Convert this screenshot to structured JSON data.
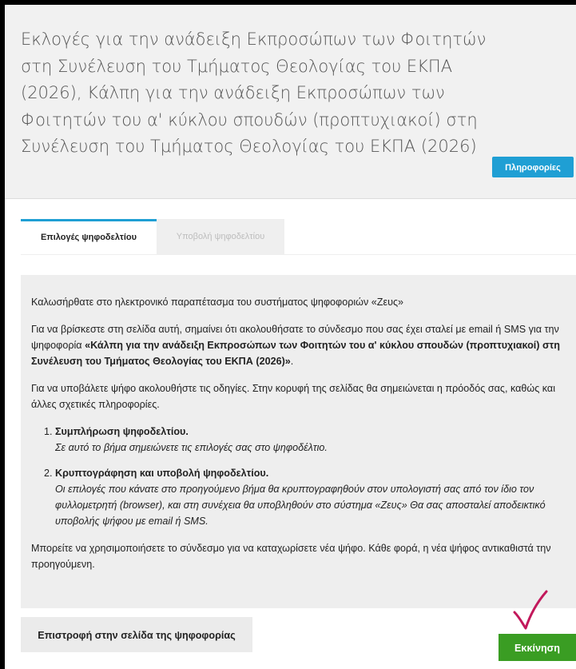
{
  "header": {
    "title": "Εκλογές για την ανάδειξη Εκπροσώπων των Φοιτητών στη Συνέλευση του Τμήματος Θεολογίας του ΕΚΠΑ (2026), Κάλπη για την ανάδειξη Εκπροσώπων των Φοιτητών του α' κύκλου σπουδών (προπτυχιακοί) στη Συνέλευση του Τμήματος Θεολογίας του ΕΚΠΑ (2026)",
    "info_label": "Πληροφορίες"
  },
  "tabs": [
    {
      "label": "Επιλογές ψηφοδελτίου",
      "active": true
    },
    {
      "label": "Υποβολή ψηφοδελτίου",
      "active": false
    }
  ],
  "panel": {
    "welcome": "Καλωσήρθατε στο ηλεκτρονικό παραπέτασμα του συστήματος ψηφοφοριών «Ζευς»",
    "intro_before": "Για να βρίσκεστε στη σελίδα αυτή, σημαίνει ότι ακολουθήσατε το σύνδεσμο που σας έχει σταλεί με email ή SMS για την ψηφοφορία ",
    "intro_bold": "«Κάλπη για την ανάδειξη Εκπροσώπων των Φοιτητών του α' κύκλου σπουδών (προπτυχιακοί) στη Συνέλευση του Τμήματος Θεολογίας του ΕΚΠΑ (2026)»",
    "intro_after": ".",
    "instructions": "Για να υποβάλετε ψήφο ακολουθήστε τις οδηγίες. Στην κορυφή της σελίδας θα σημειώνεται η πρόοδός σας, καθώς και άλλες σχετικές πληροφορίες.",
    "steps": [
      {
        "title": "Συμπλήρωση ψηφοδελτίου.",
        "desc": "Σε αυτό το βήμα σημειώνετε τις επιλογές σας στο ψηφοδέλτιο."
      },
      {
        "title": "Κρυπτογράφηση και υποβολή ψηφοδελτίου.",
        "desc": "Οι επιλογές που κάνατε στο προηγούμενο βήμα θα κρυπτογραφηθούν στον υπολογιστή σας από τον ίδιο τον φυλλομετρητή (browser), και στη συνέχεια θα υποβληθούν στο σύστημα «Ζευς» Θα σας αποσταλεί αποδεικτικό υποβολής ψήφου με email ή SMS."
      }
    ],
    "footer_note": "Μπορείτε να χρησιμοποιήσετε το σύνδεσμο για να καταχωρίσετε νέα ψήφο. Κάθε φορά, η νέα ψήφος αντικαθιστά την προηγούμενη."
  },
  "actions": {
    "back_label": "Επιστροφή στην σελίδα της ψηφοφορίας",
    "start_label": "Εκκίνηση"
  },
  "colors": {
    "accent": "#1f9fd4",
    "start": "#3a9d23",
    "annotation": "#c2185b"
  }
}
